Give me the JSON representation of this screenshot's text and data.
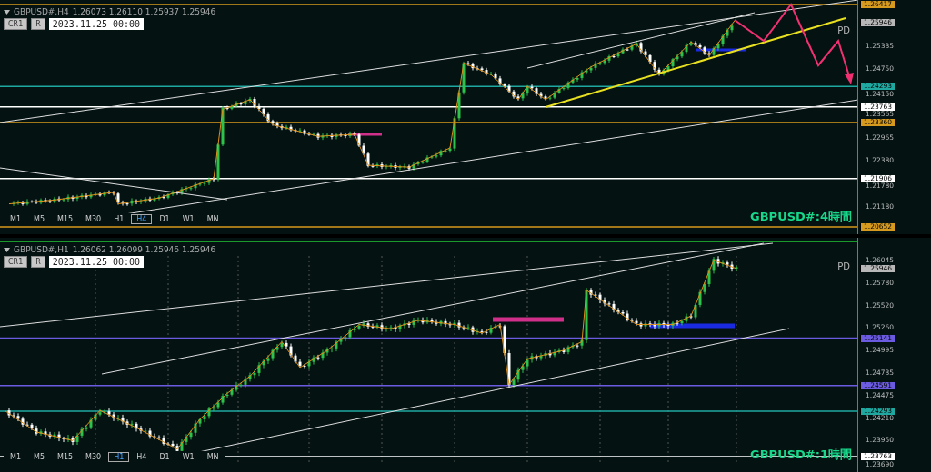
{
  "panels": [
    {
      "symbol": "GBPUSD#,H4",
      "ohlc": "1.26073 1.26110 1.25937 1.25946",
      "buttons": [
        "CR1",
        "R"
      ],
      "date": "2023.11.25 00:00",
      "pd": "PD",
      "label": "GBPUSD#:4時間",
      "ticks": [
        "1.25335",
        "1.24750",
        "1.24150",
        "1.23565",
        "1.22965",
        "1.22380",
        "1.21780",
        "1.21180"
      ],
      "tags": [
        {
          "price": "1.26417",
          "color": "#d69a1e",
          "kind": "level"
        },
        {
          "price": "1.25946",
          "color": "#b8b8b8",
          "kind": "bid"
        },
        {
          "price": "1.24293",
          "color": "#1fa8a0",
          "kind": "level"
        },
        {
          "price": "1.23763",
          "color": "#ffffff",
          "kind": "level"
        },
        {
          "price": "1.23360",
          "color": "#d69a1e",
          "kind": "level"
        },
        {
          "price": "1.21906",
          "color": "#ffffff",
          "kind": "level"
        },
        {
          "price": "1.20652",
          "color": "#d69a1e",
          "kind": "level"
        }
      ],
      "timeframes": [
        {
          "label": "M1",
          "selected": false
        },
        {
          "label": "M5",
          "selected": false
        },
        {
          "label": "M15",
          "selected": false
        },
        {
          "label": "M30",
          "selected": false
        },
        {
          "label": "H1",
          "selected": false
        },
        {
          "label": "H4",
          "selected": true
        },
        {
          "label": "D1",
          "selected": false
        },
        {
          "label": "W1",
          "selected": false
        },
        {
          "label": "MN",
          "selected": false
        }
      ]
    },
    {
      "symbol": "GBPUSD#,H1",
      "ohlc": "1.26062 1.26099 1.25946 1.25946",
      "buttons": [
        "CR1",
        "R"
      ],
      "date": "2023.11.25 00:00",
      "pd": "PD",
      "label": "GBPUSD#:1時間",
      "ticks": [
        "1.26045",
        "1.25780",
        "1.25520",
        "1.25260",
        "1.24995",
        "1.24735",
        "1.24475",
        "1.24210",
        "1.23950",
        "1.23690"
      ],
      "tags": [
        {
          "price": "1.25946",
          "color": "#b8b8b8",
          "kind": "bid"
        },
        {
          "price": "1.25141",
          "color": "#6a5be0",
          "kind": "level"
        },
        {
          "price": "1.24591",
          "color": "#6a5be0",
          "kind": "level"
        },
        {
          "price": "1.24293",
          "color": "#1fa8a0",
          "kind": "level"
        },
        {
          "price": "1.23763",
          "color": "#ffffff",
          "kind": "level"
        }
      ],
      "timeframes": [
        {
          "label": "M1",
          "selected": false
        },
        {
          "label": "M5",
          "selected": false
        },
        {
          "label": "M15",
          "selected": false
        },
        {
          "label": "M30",
          "selected": false
        },
        {
          "label": "H1",
          "selected": true
        },
        {
          "label": "H4",
          "selected": false
        },
        {
          "label": "D1",
          "selected": false
        },
        {
          "label": "W1",
          "selected": false
        },
        {
          "label": "MN",
          "selected": false
        }
      ]
    }
  ]
}
